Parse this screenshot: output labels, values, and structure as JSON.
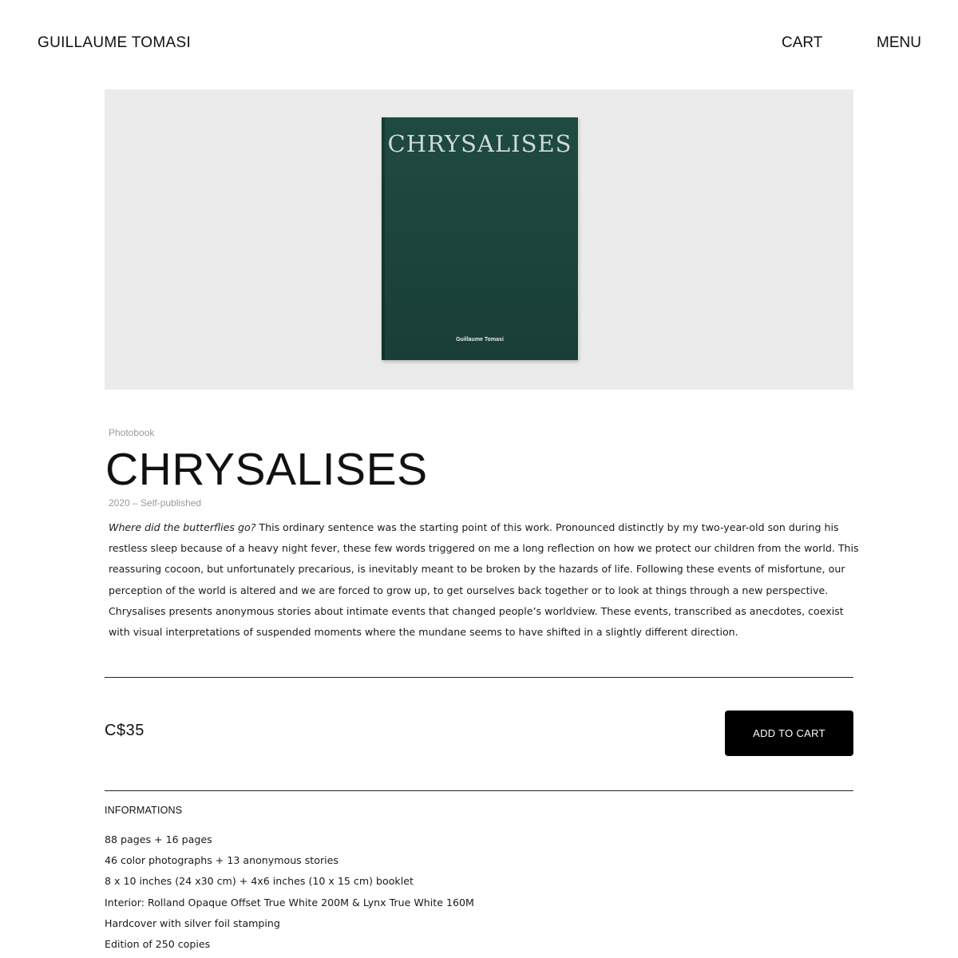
{
  "header": {
    "brand": "GUILLAUME TOMASI",
    "cart_label": "CART",
    "menu_label": "MENU"
  },
  "hero": {
    "book_cover_title": "CHRYSALISES",
    "book_cover_author": "Guillaume Tomasi",
    "book_color": "#1c443c",
    "background_color": "#ebebeb"
  },
  "product": {
    "category": "Photobook",
    "title": "CHRYSALISES",
    "meta": "2020 – Self-published",
    "description_lead": "Where did the butterflies go?",
    "description_body": " This ordinary sentence was the starting point of this work. Pronounced distinctly by my two-year-old son during his restless sleep because of a heavy night fever, these few words triggered on me a long reflection on how we protect our children from the world. This reassuring cocoon, but unfortunately precarious, is inevitably meant to be broken by the hazards of life. Following these events of misfortune, our perception of the world is altered and we are forced to grow up, to get ourselves back together or to look at things through a new perspective. Chrysalises presents anonymous stories about intimate events that changed people’s worldview. These events, transcribed as anecdotes, coexist with visual interpretations of suspended moments where the mundane seems to have shifted in a slightly different direction.",
    "price": "C$35",
    "add_to_cart_label": "ADD TO CART"
  },
  "informations": {
    "heading": "INFORMATIONS",
    "items": [
      "88 pages + 16 pages",
      "46 color photographs + 13 anonymous stories",
      "8 x 10 inches (24 x30 cm) + 4x6 inches (10 x 15 cm) booklet",
      "Interior: Rolland Opaque Offset True White 200M & Lynx True White 160M",
      "Hardcover with silver foil stamping",
      "Edition of 250 copies"
    ]
  },
  "colors": {
    "accent": "#000000",
    "muted_text": "#9a9a9a"
  }
}
